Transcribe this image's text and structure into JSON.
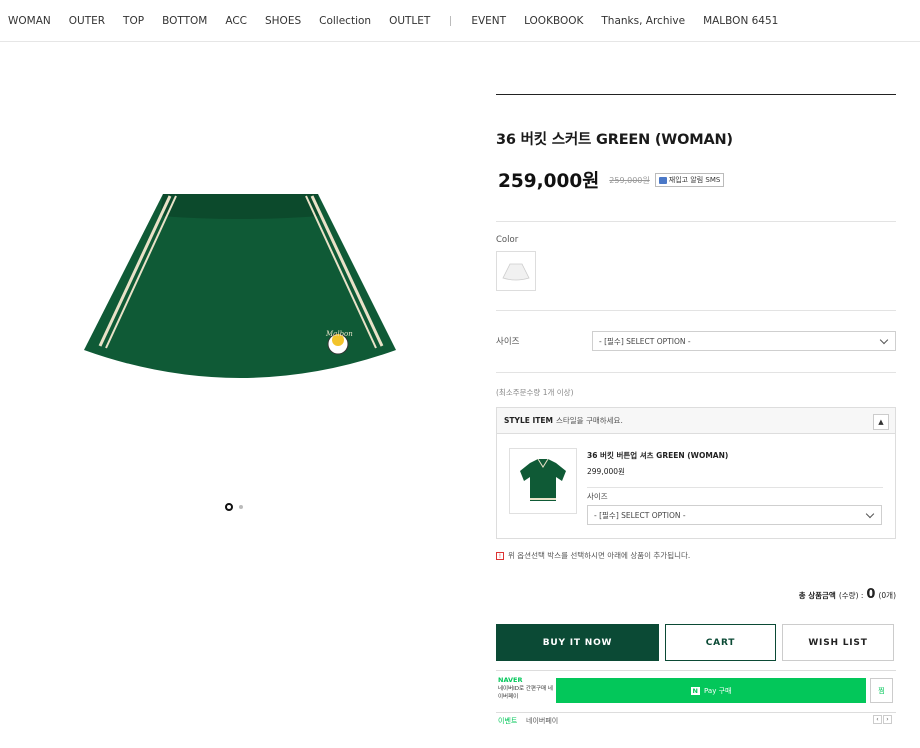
{
  "nav": {
    "items": [
      "WOMAN",
      "OUTER",
      "TOP",
      "BOTTOM",
      "ACC",
      "SHOES",
      "Collection",
      "OUTLET"
    ],
    "items2": [
      "EVENT",
      "LOOKBOOK",
      "Thanks, Archive",
      "MALBON 6451"
    ]
  },
  "product": {
    "title": "36 버킷 스커트 GREEN (WOMAN)",
    "price": "259,000원",
    "original_price": "259,000원",
    "sms_label": "재입고 알림 SMS",
    "color_label": "Color",
    "size_label": "사이즈",
    "size_select": "- [필수] SELECT OPTION -",
    "min_qty": "(최소주문수량 1개 이상)",
    "image_logo": "Malbon"
  },
  "style_item": {
    "head_bold": "STYLE ITEM",
    "head_text": "스타일을 구매하세요.",
    "toggle": "▲",
    "name": "36 버킷 버튼업 셔츠 GREEN (WOMAN)",
    "price": "299,000원",
    "size_label": "사이즈",
    "size_select": "- [필수] SELECT OPTION -"
  },
  "notice": "위 옵션선택 박스를 선택하시면 아래에 상품이 추가됩니다.",
  "total": {
    "label": "총 상품금액",
    "qty_label": "(수량) :",
    "value": "0",
    "unit": "(0개)"
  },
  "buttons": {
    "buy": "BUY IT NOW",
    "cart": "CART",
    "wish": "WISH LIST"
  },
  "naver": {
    "brand": "NAVER",
    "desc": "네이버ID로 간편구매 네이버페이",
    "pay_label": "Pay 구매",
    "n_badge": "N",
    "wish_label": "찜"
  },
  "event": {
    "label": "이벤트",
    "text": "네이버페이",
    "prev": "‹",
    "next": "›"
  },
  "colors": {
    "accent": "#0b4a35",
    "naver": "#03c75a",
    "skirt": "#0f5a36"
  }
}
